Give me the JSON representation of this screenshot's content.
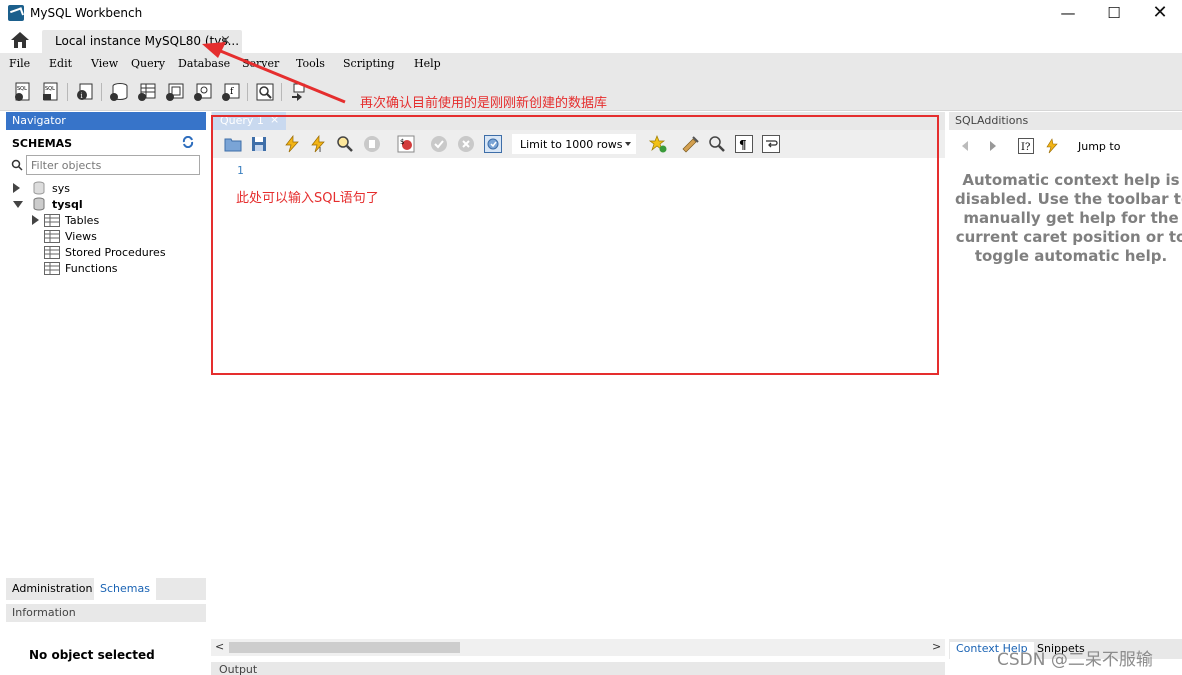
{
  "window": {
    "title": "MySQL Workbench",
    "minimize": "—",
    "maximize": "☐",
    "close": "✕"
  },
  "connection_tab": {
    "label": "Local instance MySQL80 (tys...",
    "close": "×"
  },
  "menu": [
    "File",
    "Edit",
    "View",
    "Query",
    "Database",
    "Server",
    "Tools",
    "Scripting",
    "Help"
  ],
  "navigator": {
    "header": "Navigator",
    "schemas_label": "SCHEMAS",
    "filter_placeholder": "Filter objects",
    "tree": {
      "sys": "sys",
      "tysql": "tysql",
      "tables": "Tables",
      "views": "Views",
      "procedures": "Stored Procedures",
      "functions": "Functions"
    },
    "tabs": {
      "administration": "Administration",
      "schemas": "Schemas"
    }
  },
  "information": {
    "header": "Information",
    "text": "No object selected"
  },
  "editor": {
    "tab_label": "Query 1",
    "tab_close": "×",
    "limit_label": "Limit to 1000 rows",
    "line_number": "1",
    "annotation": "此处可以输入SQL语句了"
  },
  "output": {
    "header": "Output"
  },
  "additions": {
    "header": "SQLAdditions",
    "jump_label": "Jump to",
    "help_lines": [
      "Automatic context help is",
      "disabled. Use the toolbar to",
      "manually get help for the",
      "current caret position or to",
      "toggle automatic help."
    ],
    "tabs": {
      "context_help": "Context Help",
      "snippets": "Snippets"
    }
  },
  "overlay": {
    "arrow_annotation": "再次确认目前使用的是刚刚新创建的数据库",
    "watermark": "CSDN @二呆不服输"
  },
  "colors": {
    "accent_red": "#e52e2e",
    "navigator_blue": "#3774c9",
    "help_gray": "#7f7f7f"
  }
}
